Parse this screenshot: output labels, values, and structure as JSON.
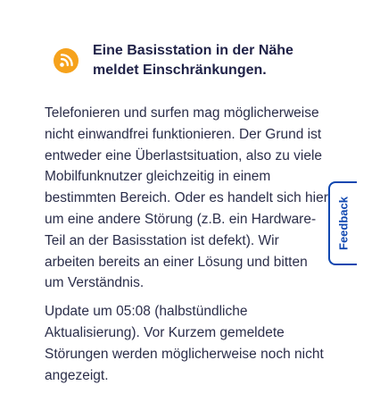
{
  "alert": {
    "icon": "signal-broadcast-icon",
    "icon_color": "#f6a21c",
    "title": "Eine Basisstation in der Nähe meldet Einschränkungen."
  },
  "message": {
    "body": "Telefonieren und surfen mag möglicherweise nicht einwandfrei funktionieren. Der Grund ist entweder eine Überlastsituation, also zu viele Mobilfunknutzer gleichzeitig in einem bestimmten Bereich. Oder es handelt sich hier um eine andere Störung (z.B. ein Hardware-Teil an der Basisstation ist defekt). Wir arbeiten bereits an einer Lösung und bitten um Verständnis.",
    "update": "Update um 05:08 (halbstündliche Aktualisierung). Vor Kurzem gemeldete Störungen werden möglicherweise noch nicht angezeigt."
  },
  "feedback": {
    "label": "Feedback",
    "accent_color": "#0f47b0"
  }
}
